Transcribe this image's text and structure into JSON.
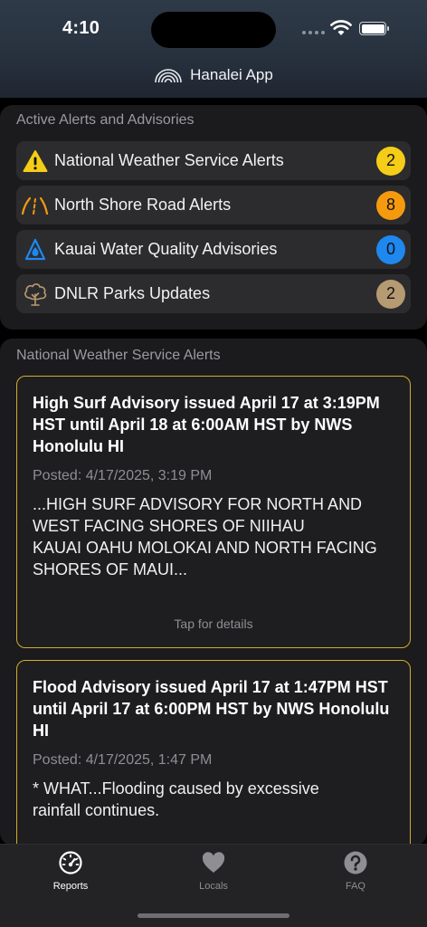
{
  "status_bar": {
    "time": "4:10"
  },
  "app": {
    "title": "Hanalei App"
  },
  "alerts_section": {
    "title": "Active Alerts and Advisories",
    "items": [
      {
        "label": "National Weather Service Alerts",
        "count": "2",
        "icon": "warning-triangle-icon",
        "badge_color": "#f5cc18"
      },
      {
        "label": "North Shore Road Alerts",
        "count": "8",
        "icon": "road-icon",
        "badge_color": "#f59a0e"
      },
      {
        "label": "Kauai Water Quality Advisories",
        "count": "0",
        "icon": "water-drop-icon",
        "badge_color": "#1e88ef"
      },
      {
        "label": "DNLR Parks Updates",
        "count": "2",
        "icon": "tree-icon",
        "badge_color": "#b69a72"
      }
    ]
  },
  "nws_section": {
    "title": "National Weather Service Alerts",
    "cards": [
      {
        "title": "High Surf Advisory issued April 17 at 3:19PM HST until April 18 at 6:00AM HST by NWS Honolulu HI",
        "posted": "Posted: 4/17/2025, 3:19 PM",
        "body_lines": [
          "...HIGH SURF ADVISORY FOR NORTH AND",
          "WEST FACING SHORES OF NIIHAU",
          "KAUAI OAHU MOLOKAI AND NORTH FACING",
          "SHORES OF MAUI..."
        ],
        "tap": "Tap for details"
      },
      {
        "title": "Flood Advisory issued April 17 at 1:47PM HST until April 17 at 6:00PM HST by NWS Honolulu HI",
        "posted": "Posted: 4/17/2025, 1:47 PM",
        "body_lines": [
          "* WHAT...Flooding caused by excessive",
          "rainfall continues."
        ]
      }
    ]
  },
  "tab_bar": {
    "tabs": [
      {
        "label": "Reports",
        "icon": "speedometer-icon",
        "active": true
      },
      {
        "label": "Locals",
        "icon": "heart-icon",
        "active": false
      },
      {
        "label": "FAQ",
        "icon": "question-circle-icon",
        "active": false
      }
    ]
  },
  "colors": {
    "card_border": "#d3ab2f",
    "inactive_tab": "#8e8e93"
  }
}
